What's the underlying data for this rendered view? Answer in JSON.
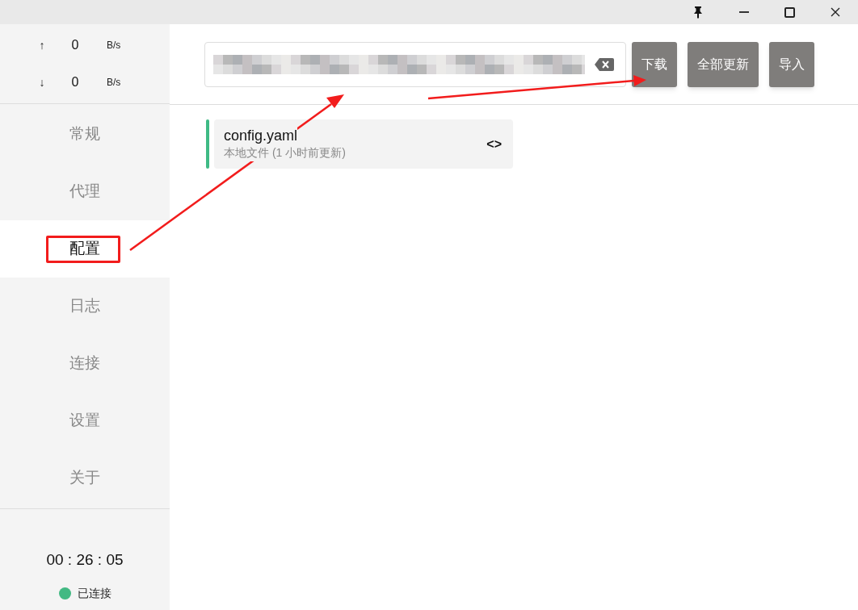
{
  "traffic": [
    {
      "arrow": "↑",
      "value": "0",
      "unit": "B/s"
    },
    {
      "arrow": "↓",
      "value": "0",
      "unit": "B/s"
    }
  ],
  "nav": [
    {
      "label": "常规",
      "selected": false
    },
    {
      "label": "代理",
      "selected": false
    },
    {
      "label": "配置",
      "selected": true
    },
    {
      "label": "日志",
      "selected": false
    },
    {
      "label": "连接",
      "selected": false
    },
    {
      "label": "设置",
      "selected": false
    },
    {
      "label": "关于",
      "selected": false
    }
  ],
  "uptime": "00 : 26 : 05",
  "status": {
    "label": "已连接",
    "color": "#42b983"
  },
  "buttons": [
    "下载",
    "全部更新",
    "导入"
  ],
  "profiles": [
    {
      "name": "config.yaml",
      "detail": "本地文件 (1 小时前更新)",
      "selected": true,
      "toggle": "<>"
    }
  ]
}
